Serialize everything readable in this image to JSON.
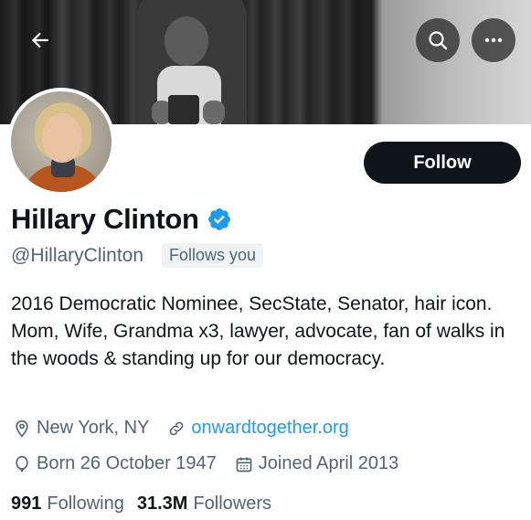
{
  "profile": {
    "name": "Hillary Clinton",
    "handle": "@HillaryClinton",
    "follows_you": "Follows you",
    "bio": "2016 Democratic Nominee, SecState, Senator, hair icon. Mom, Wife, Grandma x3, lawyer, advocate, fan of walks in the woods & standing up for our democracy.",
    "location": "New York, NY",
    "website": "onwardtogether.org",
    "birthday": "Born 26 October 1947",
    "joined": "Joined April 2013",
    "following_count": "991",
    "following_label": "Following",
    "followers_count": "31.3M",
    "followers_label": "Followers"
  },
  "actions": {
    "follow_label": "Follow",
    "back_icon": "back-arrow-icon",
    "search_icon": "search-icon",
    "more_icon": "more-icon"
  },
  "colors": {
    "accent": "#1d9bf0",
    "text_primary": "#0f1419",
    "text_secondary": "#536471",
    "button_dark": "#0f1419"
  }
}
